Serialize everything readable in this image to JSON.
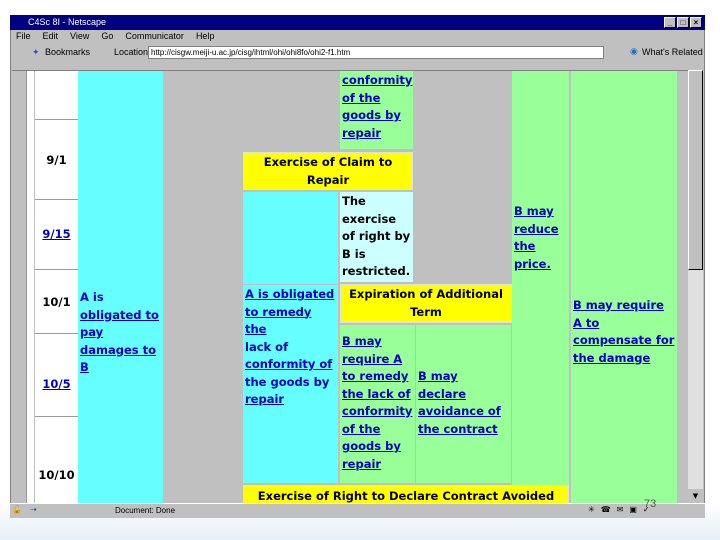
{
  "window": {
    "title": "C4Sc 8I - Netscape",
    "controls": [
      "_",
      "□",
      "×"
    ]
  },
  "menu": [
    "File",
    "Edit",
    "View",
    "Go",
    "Communicator",
    "Help"
  ],
  "toolbar": {
    "bookmarks": "Bookmarks",
    "location_label": "Location:",
    "url": "http://cisgw.meiji-u.ac.jp/cisg/ihtml/ohi/ohi8fo/ohi2-f1.htm",
    "related": "What's Related"
  },
  "dates": [
    {
      "text": "9/1",
      "link": false
    },
    {
      "text": "9/15",
      "link": true
    },
    {
      "text": "10/1",
      "link": false
    },
    {
      "text": "10/5",
      "link": true
    },
    {
      "text": "10/10",
      "link": false
    }
  ],
  "cells": {
    "top_conformity": "conformity of the goods by repair",
    "claim_repair": "Exercise of Claim to Repair",
    "restricted": "The exercise of right by B is restricted.",
    "reduce_price": "B may reduce the price.",
    "pay_damages_a": "A is",
    "pay_damages_b": "obligated to pay damages to B",
    "obligated_remedy_a": "A is obligated to remedy the",
    "obligated_remedy_b": "lack of",
    "obligated_remedy_c": "conformity of",
    "obligated_remedy_d": "the goods by",
    "obligated_remedy_e": "repair",
    "expiration": "Expiration of Additional Term",
    "require_remedy": "B may require A to remedy the lack of conformity of the goods by repair",
    "declare_avoidance": "B may declare avoidance of the contract",
    "compensate": "B may require A to compensate for the damage",
    "declare_avoided": "Exercise of Right to Declare Contract Avoided"
  },
  "status": {
    "text": "Document: Done"
  },
  "slide_number": "73",
  "colors": {
    "yellow": "#ffff00",
    "cyan": "#66ffff",
    "light_cyan": "#ccffff",
    "green": "#99ff99",
    "link": "#0000c0"
  }
}
